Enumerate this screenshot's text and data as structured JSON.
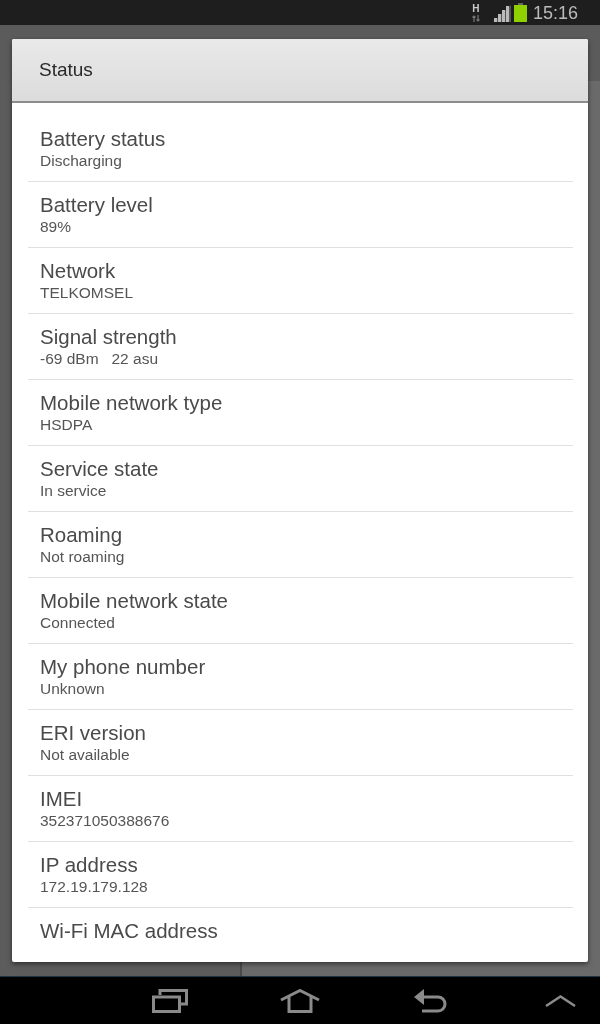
{
  "status_bar": {
    "network_type": "H",
    "time": "15:16"
  },
  "dialog": {
    "title": "Status",
    "items": [
      {
        "label": "Battery status",
        "summary": "Discharging"
      },
      {
        "label": "Battery level",
        "summary": "89%"
      },
      {
        "label": "Network",
        "summary": "TELKOMSEL"
      },
      {
        "label": "Signal strength",
        "summary": "-69 dBm   22 asu"
      },
      {
        "label": "Mobile network type",
        "summary": "HSDPA"
      },
      {
        "label": "Service state",
        "summary": "In service"
      },
      {
        "label": "Roaming",
        "summary": "Not roaming"
      },
      {
        "label": "Mobile network state",
        "summary": "Connected"
      },
      {
        "label": "My phone number",
        "summary": "Unknown"
      },
      {
        "label": "ERI version",
        "summary": "Not available"
      },
      {
        "label": "IMEI",
        "summary": "352371050388676"
      },
      {
        "label": "IP address",
        "summary": "172.19.179.128"
      },
      {
        "label": "Wi-Fi MAC address"
      }
    ]
  }
}
